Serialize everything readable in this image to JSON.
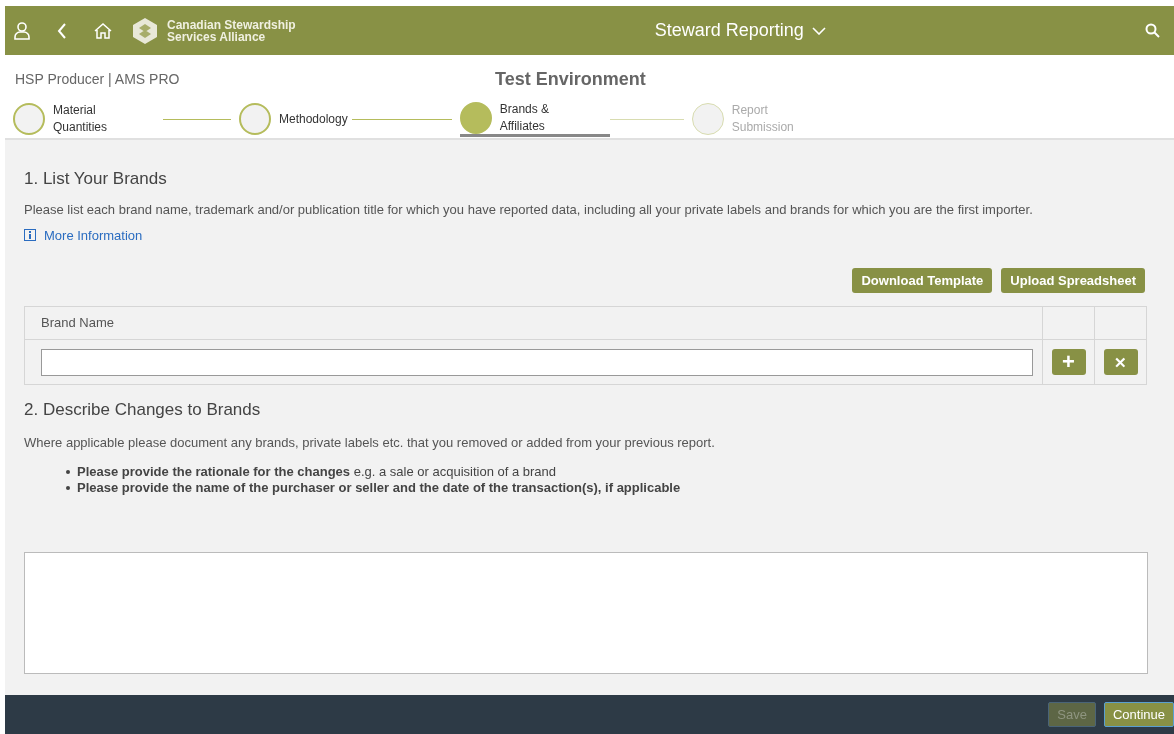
{
  "header": {
    "logo_text": [
      "Canadian Stewardship",
      "Services Alliance"
    ],
    "title": "Steward Reporting"
  },
  "subheader": {
    "account": "HSP Producer | AMS PRO",
    "environment": "Test Environment"
  },
  "steps": [
    {
      "label": [
        "Material",
        "Quantities"
      ],
      "kind": "done",
      "selected": false
    },
    {
      "label": [
        "Methodology"
      ],
      "kind": "done",
      "selected": false
    },
    {
      "label": [
        "Brands &",
        "Affiliates"
      ],
      "kind": "current",
      "selected": true
    },
    {
      "label": [
        "Report",
        "Submission"
      ],
      "kind": "upcoming",
      "selected": false
    }
  ],
  "section1": {
    "heading": "1. List Your Brands",
    "description": "Please list each brand name, trademark and/or publication title for which you have reported data, including all your private labels and brands for which you are the first importer.",
    "link": "More Information",
    "buttons": [
      "Download Template",
      "Upload Spreadsheet"
    ],
    "table": {
      "columns": [
        "Brand Name"
      ],
      "add": "+",
      "remove": "✕"
    }
  },
  "section2": {
    "heading": "2. Describe Changes to Brands",
    "description": "Where applicable please document any brands, private labels etc. that you removed or added from your previous report.",
    "bullets": [
      {
        "text": "**Please provide the rationale for the changes** e.g. a sale or acquisition of a brand",
        "bold": false
      },
      {
        "text": "Please provide the name of the purchaser or seller and the date of the transaction(s), if applicable",
        "bold": true
      }
    ]
  },
  "footer": {
    "buttons": [
      {
        "label": "Save",
        "disabled": true
      },
      {
        "label": "Continue",
        "disabled": false
      }
    ]
  }
}
